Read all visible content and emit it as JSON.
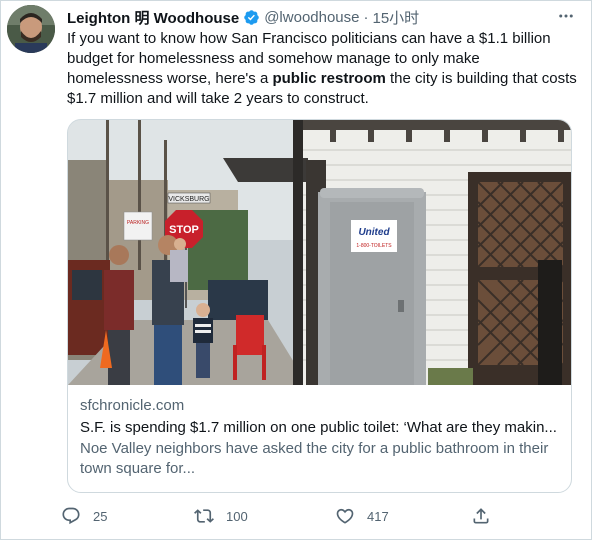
{
  "author": {
    "name": "Leighton 明 Woodhouse",
    "handle": "@lwoodhouse",
    "separator": "·",
    "time": "15小时"
  },
  "tweet": {
    "text_part1": "If you want to know how San Francisco politicians can have a $1.1 billion budget for homelessness and somehow manage to only make homelessness worse, here's a ",
    "text_bold": "public restroom",
    "text_part2": " the city is building that costs $1.7 million and will take 2 years to construct."
  },
  "card": {
    "domain": "sfchronicle.com",
    "title": "S.F. is spending $1.7 million on one public toilet: ‘What are they makin...",
    "description": "Noe Valley neighbors have asked the city for a public bathroom in their town square for...",
    "image": {
      "street_sign": "VICKSBURG",
      "stop_sign": "STOP",
      "toilet_brand": "United",
      "toilet_phone": "1-800-TOILETS",
      "parking_sign": "PARKING"
    }
  },
  "actions": {
    "replies": "25",
    "retweets": "100",
    "likes": "417"
  },
  "colors": {
    "verified": "#1d9bf0",
    "secondary_text": "#536471",
    "border": "#cfd9de"
  }
}
